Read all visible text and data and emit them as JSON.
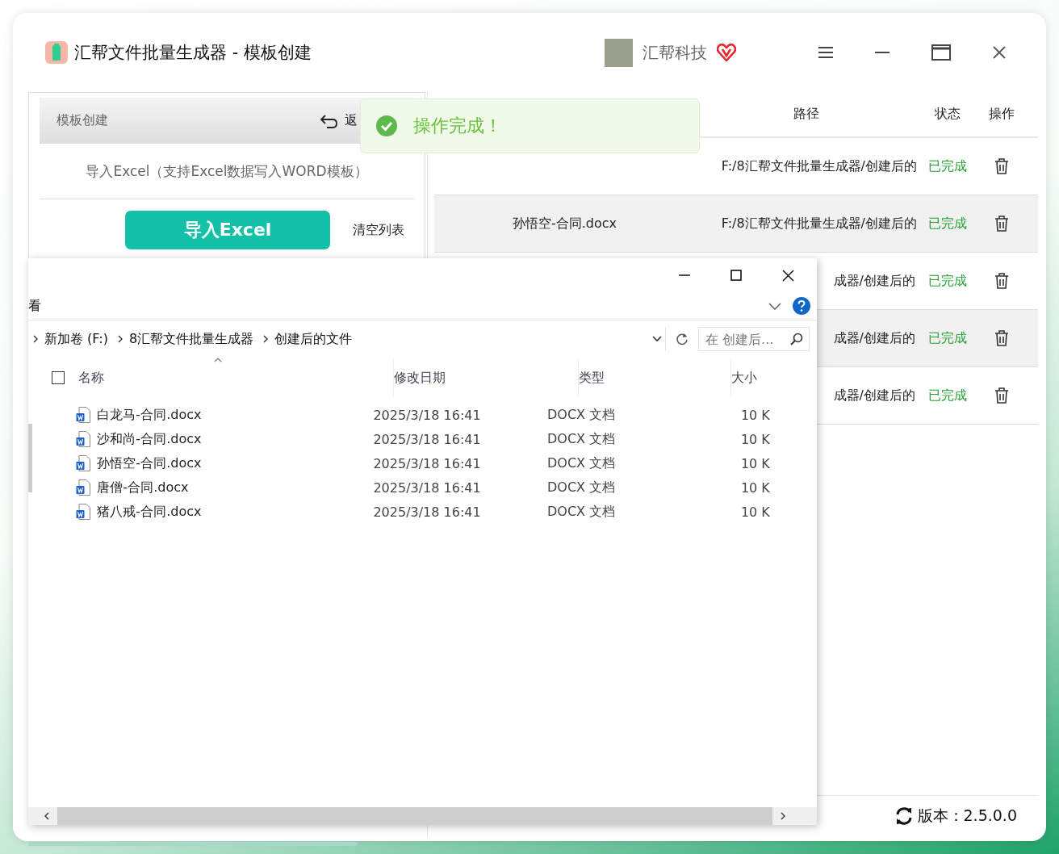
{
  "window": {
    "title": "汇帮文件批量生成器 - 模板创建",
    "user": "汇帮科技"
  },
  "left_panel": {
    "header": "模板创建",
    "back": "返",
    "hint": "导入Excel（支持Excel数据写入WORD模板）",
    "import_button": "导入Excel",
    "clear_link": "清空列表"
  },
  "file_table": {
    "columns": [
      "路径",
      "状态",
      "操作"
    ],
    "rows": [
      {
        "path": "F:/8汇帮文件批量生成器/创建后的",
        "status": "已完成"
      },
      {
        "name": "孙悟空-合同.docx",
        "path": "F:/8汇帮文件批量生成器/创建后的",
        "status": "已完成"
      },
      {
        "path": "成器/创建后的",
        "status": "已完成"
      },
      {
        "path": "成器/创建后的",
        "status": "已完成"
      },
      {
        "path": "成器/创建后的",
        "status": "已完成"
      }
    ]
  },
  "status_bar": {
    "version": "版本：2.5.0.0"
  },
  "toast": {
    "message": "操作完成！"
  },
  "explorer": {
    "ribbon_tab": "看",
    "breadcrumb": [
      "新加卷 (F:)",
      "8汇帮文件批量生成器",
      "创建后的文件"
    ],
    "search": {
      "placeholder": "在 创建后..."
    },
    "select_all": {
      "checked": false
    },
    "columns": [
      "名称",
      "修改日期",
      "类型",
      "大小"
    ],
    "rows": [
      {
        "name": "白龙马-合同.docx",
        "modified": "2025/3/18 16:41",
        "type": "DOCX 文档",
        "size": "10 K"
      },
      {
        "name": "沙和尚-合同.docx",
        "modified": "2025/3/18 16:41",
        "type": "DOCX 文档",
        "size": "10 K"
      },
      {
        "name": "孙悟空-合同.docx",
        "modified": "2025/3/18 16:41",
        "type": "DOCX 文档",
        "size": "10 K"
      },
      {
        "name": "唐僧-合同.docx",
        "modified": "2025/3/18 16:41",
        "type": "DOCX 文档",
        "size": "10 K"
      },
      {
        "name": "猪八戒-合同.docx",
        "modified": "2025/3/18 16:41",
        "type": "DOCX 文档",
        "size": "10 K"
      }
    ]
  }
}
